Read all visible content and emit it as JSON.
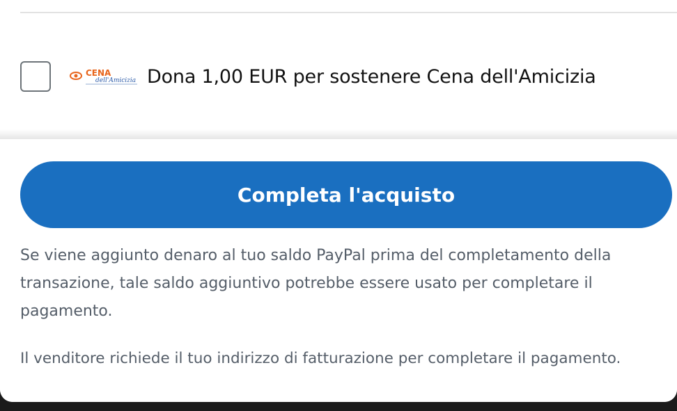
{
  "donation": {
    "checked": false,
    "text": "Dona 1,00 EUR per sostenere Cena dell'Amicizia",
    "logo": {
      "name_line1": "CENA",
      "name_line2": "dell'Amicizia",
      "colors": {
        "primary": "#e8651c",
        "secondary": "#2a5aa8"
      }
    }
  },
  "checkout": {
    "button_label": "Completa l'acquisto",
    "button_color": "#1a6fc0",
    "notice_balance": "Se viene aggiunto denaro al tuo saldo PayPal prima del completamento della transazione, tale saldo aggiuntivo potrebbe essere usato per completare il pagamento.",
    "notice_billing": "Il venditore richiede il tuo indirizzo di fatturazione per completare il pagamento."
  }
}
